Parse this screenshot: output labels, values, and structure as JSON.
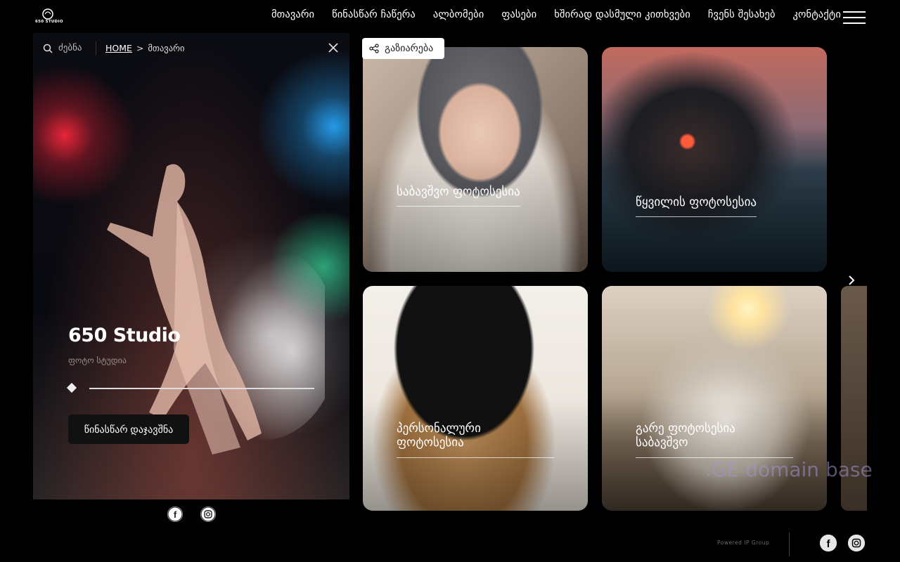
{
  "header": {
    "logo_icon": "camera-logo",
    "logo_text": "650 STUDIO",
    "nav": [
      "მთავარი",
      "წინასწარ ჩაწერა",
      "ალბომები",
      "ფასები",
      "ხშირად დასმული კითხვები",
      "ჩვენს შესახებ",
      "კონტაქტი"
    ],
    "menu_icon": "hamburger-icon"
  },
  "hero": {
    "search_placeholder": "ძებნა",
    "breadcrumb": {
      "home": "HOME",
      "separator": ">",
      "current": "მთავარი"
    },
    "title": "650 Studio",
    "subtitle": "ფოტო სტუდია",
    "book_label": "წინასწარ დაჯავშნა",
    "slider_position": 0
  },
  "share": {
    "label": "გაზიარება",
    "icon": "share-icon"
  },
  "cards": [
    {
      "label_lines": [
        "საბავშვო ფოტოსესია"
      ]
    },
    {
      "label_lines": [
        "წყვილის ფოტოსესია"
      ]
    },
    {
      "label_lines": [
        "პერსონალური",
        "ფოტოსესია"
      ]
    },
    {
      "label_lines": [
        "გარე ფოტოსესია",
        "საბავშვო"
      ]
    }
  ],
  "watermark": ".GE domain base",
  "footer": {
    "powered": "Powered IP Group",
    "social": [
      "facebook-icon",
      "instagram-icon"
    ]
  }
}
